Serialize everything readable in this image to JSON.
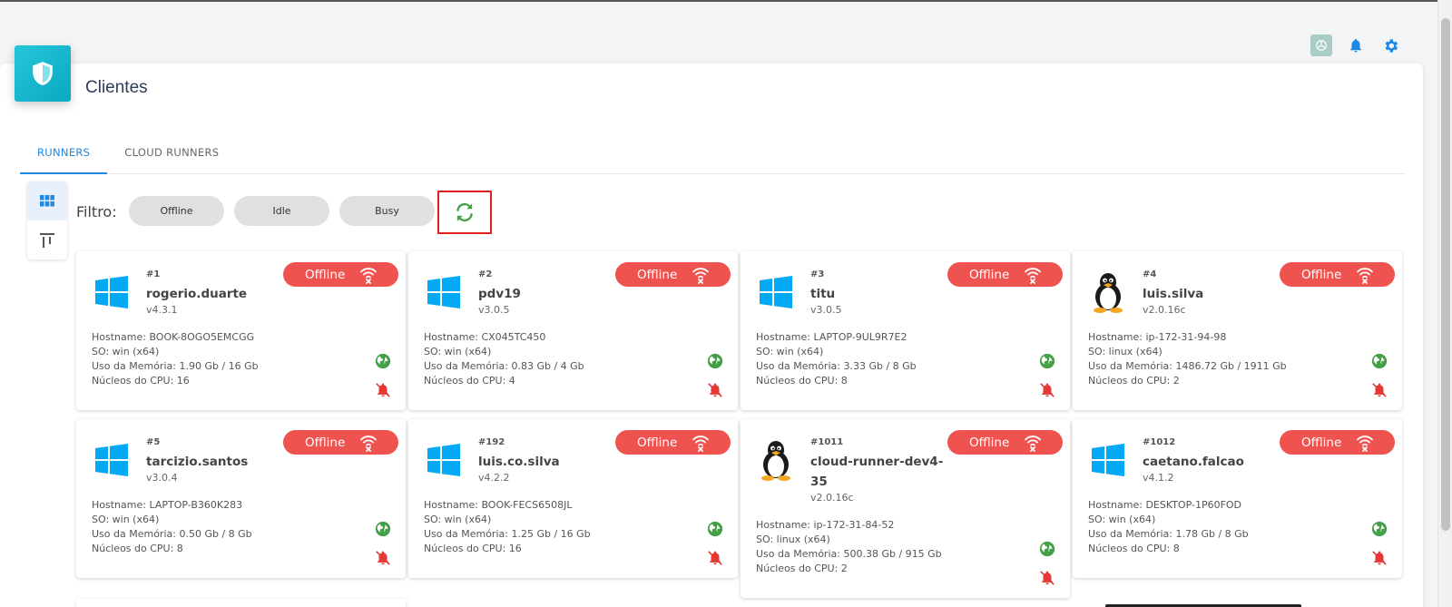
{
  "page": {
    "title": "Clientes"
  },
  "top_icons": [
    "chatgpt-icon",
    "bell-icon",
    "gear-icon"
  ],
  "tabs": [
    {
      "label": "RUNNERS",
      "active": true
    },
    {
      "label": "CLOUD RUNNERS",
      "active": false
    }
  ],
  "filter": {
    "label": "Filtro:",
    "chips": [
      "Offline",
      "Idle",
      "Busy"
    ]
  },
  "colors": {
    "accent": "#1e88e5",
    "offline": "#ef5350",
    "online_globe": "#43a047",
    "windows": "#03a9f4",
    "alert_bell": "#e53935"
  },
  "runners": [
    {
      "id": "#1",
      "name": "rogerio.duarte",
      "version": "v4.3.1",
      "os": "windows",
      "status": "Offline",
      "hostname": "Hostname: BOOK-8OGO5EMCGG",
      "so": "SO: win (x64)",
      "memory": "Uso da Memória: 1.90 Gb / 16 Gb",
      "cpu": "Núcleos do CPU: 16"
    },
    {
      "id": "#2",
      "name": "pdv19",
      "version": "v3.0.5",
      "os": "windows",
      "status": "Offline",
      "hostname": "Hostname: CX045TC450",
      "so": "SO: win (x64)",
      "memory": "Uso da Memória: 0.83 Gb / 4 Gb",
      "cpu": "Núcleos do CPU: 4"
    },
    {
      "id": "#3",
      "name": "titu",
      "version": "v3.0.5",
      "os": "windows",
      "status": "Offline",
      "hostname": "Hostname: LAPTOP-9UL9R7E2",
      "so": "SO: win (x64)",
      "memory": "Uso da Memória: 3.33 Gb / 8 Gb",
      "cpu": "Núcleos do CPU: 8"
    },
    {
      "id": "#4",
      "name": "luis.silva",
      "version": "v2.0.16c",
      "os": "linux",
      "status": "Offline",
      "hostname": "Hostname: ip-172-31-94-98",
      "so": "SO: linux (x64)",
      "memory": "Uso da Memória: 1486.72 Gb / 1911 Gb",
      "cpu": "Núcleos do CPU: 2"
    },
    {
      "id": "#5",
      "name": "tarcizio.santos",
      "version": "v3.0.4",
      "os": "windows",
      "status": "Offline",
      "hostname": "Hostname: LAPTOP-B360K283",
      "so": "SO: win (x64)",
      "memory": "Uso da Memória: 0.50 Gb / 8 Gb",
      "cpu": "Núcleos do CPU: 8"
    },
    {
      "id": "#192",
      "name": "luis.co.silva",
      "version": "v4.2.2",
      "os": "windows",
      "status": "Offline",
      "hostname": "Hostname: BOOK-FECS6508JL",
      "so": "SO: win (x64)",
      "memory": "Uso da Memória: 1.25 Gb / 16 Gb",
      "cpu": "Núcleos do CPU: 16"
    },
    {
      "id": "#1011",
      "name": "cloud-runner-dev4-35",
      "version": "v2.0.16c",
      "os": "linux",
      "status": "Offline",
      "hostname": "Hostname: ip-172-31-84-52",
      "so": "SO: linux (x64)",
      "memory": "Uso da Memória: 500.38 Gb / 915 Gb",
      "cpu": "Núcleos do CPU: 2"
    },
    {
      "id": "#1012",
      "name": "caetano.falcao",
      "version": "v4.1.2",
      "os": "windows",
      "status": "Offline",
      "hostname": "Hostname: DESKTOP-1P60FOD",
      "so": "SO: win (x64)",
      "memory": "Uso da Memória: 1.78 Gb / 8 Gb",
      "cpu": "Núcleos do CPU: 8"
    }
  ]
}
